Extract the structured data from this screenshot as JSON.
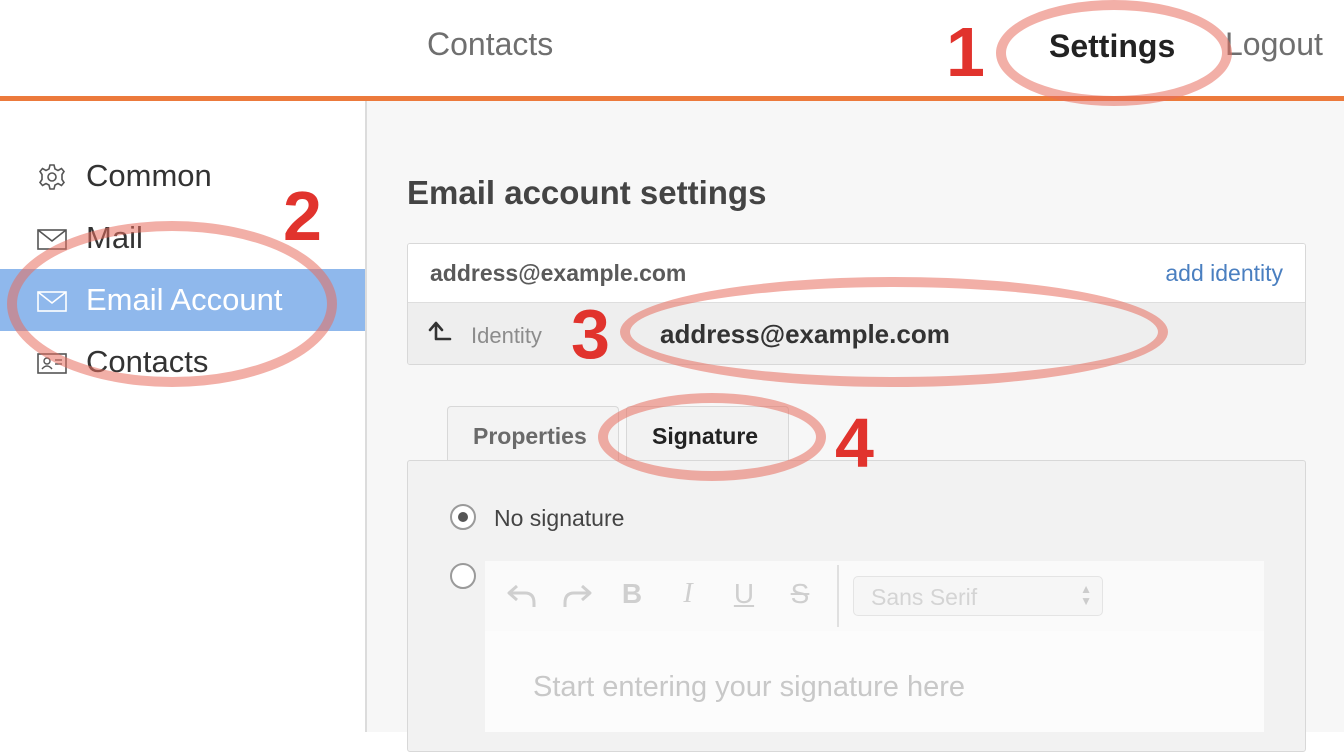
{
  "topnav": {
    "contacts": "Contacts",
    "settings": "Settings",
    "logout": "Logout",
    "accent_color": "#ec7a3c"
  },
  "sidebar": {
    "items": [
      {
        "label": "Common",
        "icon": "gear-icon",
        "active": false
      },
      {
        "label": "Mail",
        "icon": "envelope-icon",
        "active": false
      },
      {
        "label": "Email Account",
        "icon": "envelope-icon",
        "active": true
      },
      {
        "label": "Contacts",
        "icon": "contact-card-icon",
        "active": false
      }
    ],
    "active_color": "#8fb8ec"
  },
  "main": {
    "title": "Email account settings",
    "account": {
      "address": "address@example.com",
      "add_identity": "add identity"
    },
    "identity": {
      "label": "Identity",
      "address": "address@example.com"
    },
    "tabs": [
      {
        "label": "Properties",
        "active": false
      },
      {
        "label": "Signature",
        "active": true
      }
    ],
    "signature": {
      "no_signature_label": "No signature",
      "selected_option": "No signature",
      "toolbar": {
        "undo_icon": "undo-icon",
        "redo_icon": "redo-icon",
        "bold": "B",
        "italic": "I",
        "underline": "U",
        "strike": "S",
        "font": "Sans Serif"
      },
      "placeholder": "Start entering your signature here"
    }
  },
  "annotations": {
    "numbers": [
      "1",
      "2",
      "3",
      "4"
    ],
    "color": "#e1332d"
  }
}
